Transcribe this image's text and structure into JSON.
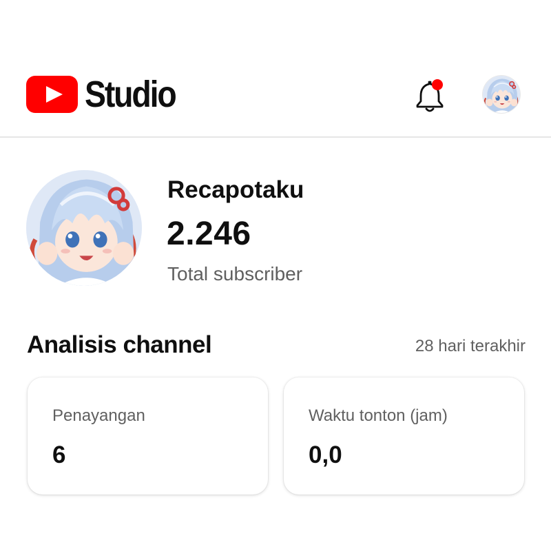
{
  "app": {
    "brand": "Studio",
    "logo_icon": "youtube-play-logo",
    "accent_color": "#ff0000"
  },
  "header": {
    "notification_icon": "bell-icon",
    "notification_badge_color": "#ff0000",
    "avatar_icon": "account-avatar"
  },
  "channel": {
    "name": "Recapotaku",
    "subscriber_count": "2.246",
    "subscriber_label": "Total subscriber"
  },
  "analytics": {
    "title": "Analisis channel",
    "period": "28 hari terakhir",
    "cards": [
      {
        "label": "Penayangan",
        "value": "6"
      },
      {
        "label": "Waktu tonton (jam)",
        "value": "0,0"
      }
    ]
  }
}
